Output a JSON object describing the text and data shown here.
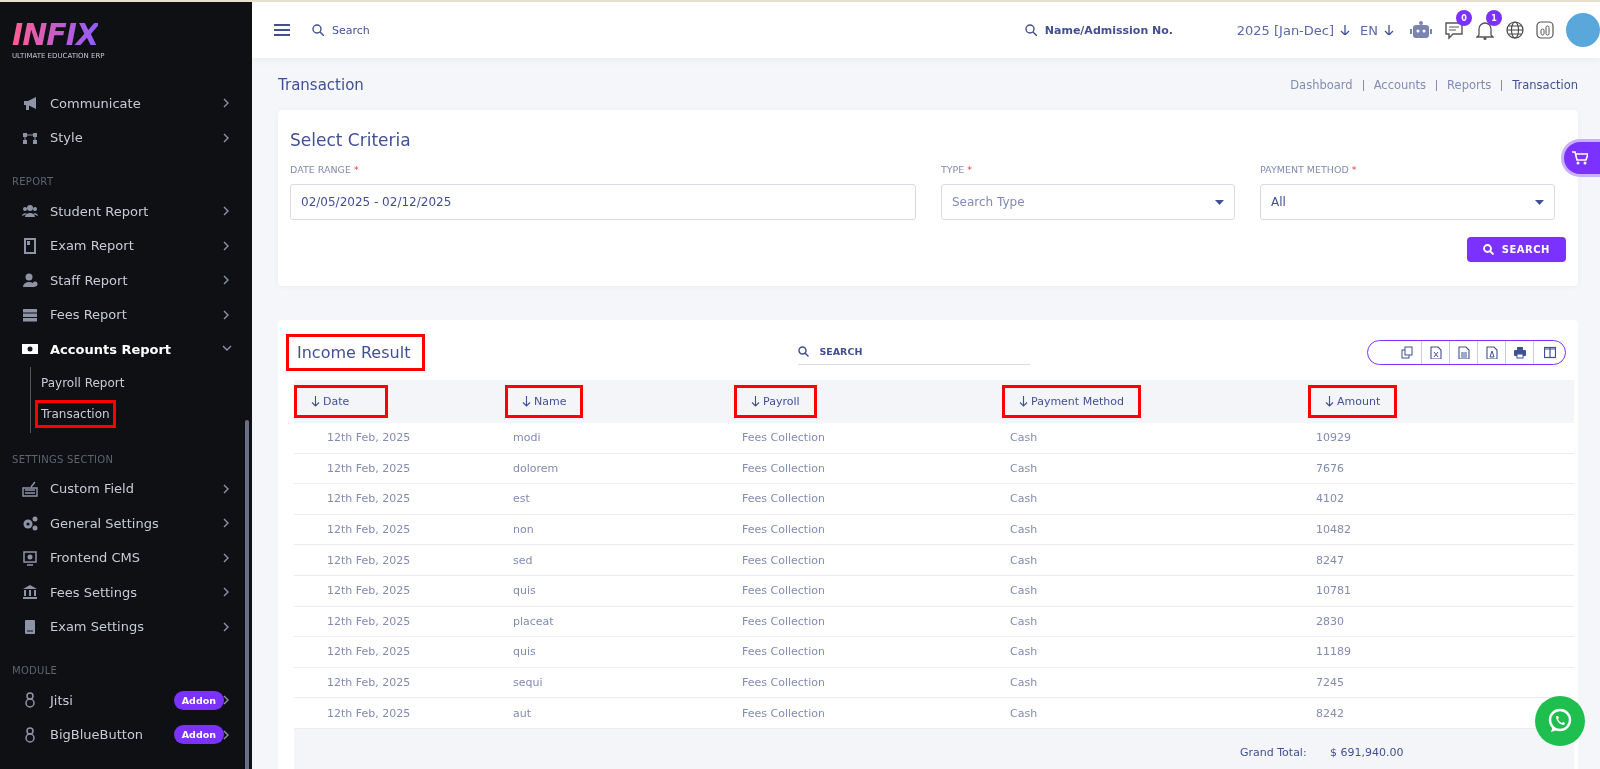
{
  "logo": {
    "title": "INFIX",
    "subtitle": "ULTIMATE EDUCATION ERP"
  },
  "sidebar": {
    "sections": [
      {
        "items": [
          {
            "label": "Communicate",
            "expanded": false
          },
          {
            "label": "Style",
            "expanded": false
          }
        ]
      },
      {
        "heading": "REPORT",
        "items": [
          {
            "label": "Student Report",
            "expanded": false
          },
          {
            "label": "Exam Report",
            "expanded": false
          },
          {
            "label": "Staff Report",
            "expanded": false
          },
          {
            "label": "Fees Report",
            "expanded": false
          },
          {
            "label": "Accounts Report",
            "expanded": true,
            "children": [
              {
                "label": "Payroll Report",
                "highlighted": false
              },
              {
                "label": "Transaction",
                "highlighted": true
              }
            ]
          }
        ]
      },
      {
        "heading": "SETTINGS SECTION",
        "items": [
          {
            "label": "Custom Field",
            "expanded": false
          },
          {
            "label": "General Settings",
            "expanded": false
          },
          {
            "label": "Frontend CMS",
            "expanded": false
          },
          {
            "label": "Fees Settings",
            "expanded": false
          },
          {
            "label": "Exam Settings",
            "expanded": false
          }
        ]
      },
      {
        "heading": "MODULE",
        "items": [
          {
            "label": "Jitsi",
            "expanded": false,
            "badge": "Addon"
          },
          {
            "label": "BigBlueButton",
            "expanded": false,
            "badge": "Addon"
          }
        ]
      }
    ]
  },
  "header": {
    "search": {
      "placeholder": "Search"
    },
    "student_search": {
      "placeholder": "Name/Admission No."
    },
    "session": "2025 [Jan-Dec]",
    "language": "EN",
    "messages_count": "0",
    "notifications_count": "1"
  },
  "page": {
    "title": "Transaction",
    "breadcrumb": [
      "Dashboard",
      "Accounts",
      "Reports",
      "Transaction"
    ]
  },
  "criteria": {
    "title": "Select Criteria",
    "fields": [
      {
        "label": "DATE RANGE",
        "mark": "*",
        "kind": "text",
        "value": "02/05/2025 - 02/12/2025"
      },
      {
        "label": "TYPE",
        "mark": "*",
        "kind": "select",
        "placeholder": "Search Type"
      },
      {
        "label": "PAYMENT METHOD",
        "mark": "*",
        "kind": "select",
        "value": "All"
      }
    ],
    "button": "SEARCH"
  },
  "result": {
    "title": "Income Result",
    "highlighted": true,
    "search": {
      "placeholder": "SEARCH"
    },
    "columns": [
      {
        "label": "Date",
        "highlighted": true
      },
      {
        "label": "Name",
        "highlighted": true
      },
      {
        "label": "Payroll",
        "highlighted": true
      },
      {
        "label": "Payment Method",
        "highlighted": true
      },
      {
        "label": "Amount",
        "highlighted": true
      }
    ],
    "rows": [
      [
        "12th Feb, 2025",
        "modi",
        "Fees Collection",
        "Cash",
        "10929"
      ],
      [
        "12th Feb, 2025",
        "dolorem",
        "Fees Collection",
        "Cash",
        "7676"
      ],
      [
        "12th Feb, 2025",
        "est",
        "Fees Collection",
        "Cash",
        "4102"
      ],
      [
        "12th Feb, 2025",
        "non",
        "Fees Collection",
        "Cash",
        "10482"
      ],
      [
        "12th Feb, 2025",
        "sed",
        "Fees Collection",
        "Cash",
        "8247"
      ],
      [
        "12th Feb, 2025",
        "quis",
        "Fees Collection",
        "Cash",
        "10781"
      ],
      [
        "12th Feb, 2025",
        "placeat",
        "Fees Collection",
        "Cash",
        "2830"
      ],
      [
        "12th Feb, 2025",
        "quis",
        "Fees Collection",
        "Cash",
        "11189"
      ],
      [
        "12th Feb, 2025",
        "sequi",
        "Fees Collection",
        "Cash",
        "7245"
      ],
      [
        "12th Feb, 2025",
        "aut",
        "Fees Collection",
        "Cash",
        "8242"
      ]
    ],
    "total_label": "Grand Total:",
    "total_value": "$ 691,940.00"
  }
}
